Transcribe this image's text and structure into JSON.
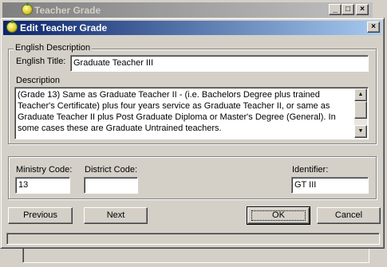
{
  "parent_window": {
    "title": "Teacher Grade",
    "buttons": {
      "minimize": "_",
      "maximize": "□",
      "close": "×"
    }
  },
  "dialog": {
    "title": "Edit Teacher Grade",
    "close_label": "×",
    "english_group_label": "English Description",
    "english_title_label": "English Title:",
    "english_title_value": "Graduate Teacher III",
    "description_label": "Description",
    "description_value": "(Grade 13) Same as Graduate Teacher II - (i.e. Bachelors Degree plus trained Teacher's Certificate) plus four years service as Graduate Teacher II, or same as Graduate Teacher II plus Post Graduate Diploma or Master's Degree (General).  In some cases these are Graduate Untrained teachers.",
    "ministry_code_label": "Ministry Code:",
    "ministry_code_value": "13",
    "district_code_label": "District Code:",
    "district_code_value": "",
    "identifier_label": "Identifier:",
    "identifier_value": "GT III",
    "buttons": {
      "previous": "Previous",
      "next": "Next",
      "ok": "OK",
      "cancel": "Cancel"
    },
    "scroll_icons": {
      "up": "▲",
      "down": "▼"
    }
  },
  "colors": {
    "active_title": "#0a246a",
    "inactive_title": "#808080",
    "face": "#d4d0c8"
  }
}
